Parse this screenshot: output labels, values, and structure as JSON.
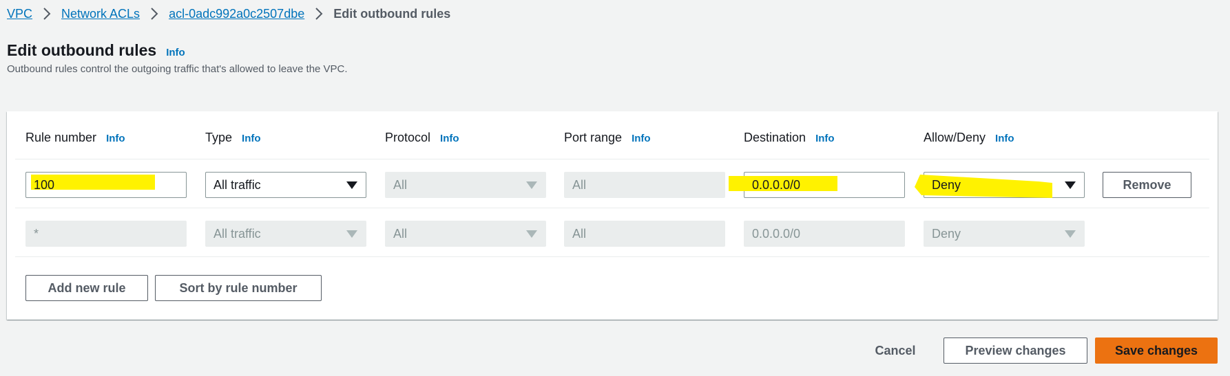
{
  "breadcrumb": {
    "items": [
      "VPC",
      "Network ACLs",
      "acl-0adc992a0c2507dbe"
    ],
    "current": "Edit outbound rules"
  },
  "header": {
    "title": "Edit outbound rules",
    "info": "Info",
    "description": "Outbound rules control the outgoing traffic that's allowed to leave the VPC."
  },
  "columns": [
    {
      "label": "Rule number",
      "info": "Info"
    },
    {
      "label": "Type",
      "info": "Info"
    },
    {
      "label": "Protocol",
      "info": "Info"
    },
    {
      "label": "Port range",
      "info": "Info"
    },
    {
      "label": "Destination",
      "info": "Info"
    },
    {
      "label": "Allow/Deny",
      "info": "Info"
    }
  ],
  "rules": [
    {
      "rule_number": "100",
      "type": "All traffic",
      "protocol": "All",
      "port_range": "All",
      "destination": "0.0.0.0/0",
      "allow_deny": "Deny",
      "remove_label": "Remove"
    },
    {
      "rule_number": "*",
      "type": "All traffic",
      "protocol": "All",
      "port_range": "All",
      "destination": "0.0.0.0/0",
      "allow_deny": "Deny"
    }
  ],
  "buttons": {
    "add_rule": "Add new rule",
    "sort": "Sort by rule number",
    "cancel": "Cancel",
    "preview": "Preview changes",
    "save": "Save changes"
  },
  "colors": {
    "link": "#0073bb",
    "highlight": "#fff200",
    "primary": "#ec7211",
    "background": "#f2f3f3"
  }
}
